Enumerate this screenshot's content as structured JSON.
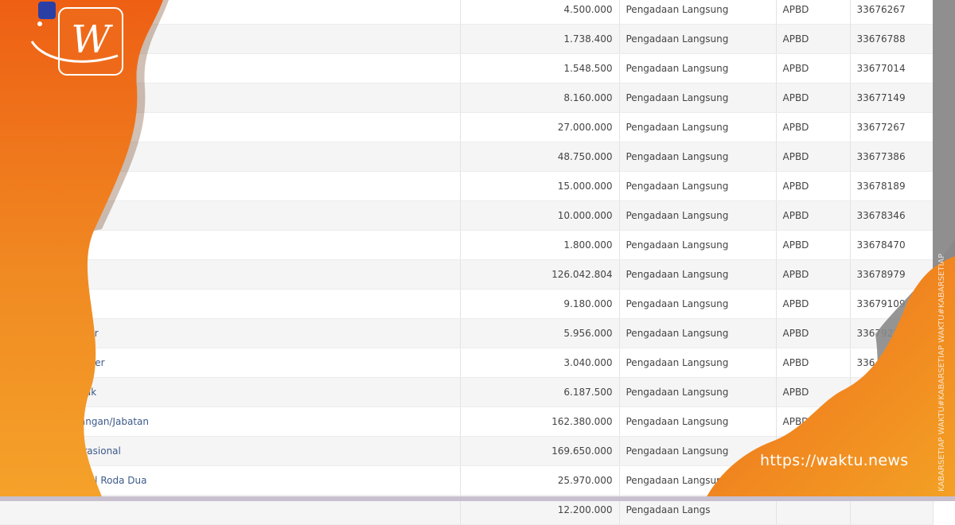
{
  "table": {
    "rows": [
      {
        "name": "",
        "value": "4.500.000",
        "method": "Pengadaan Langsung",
        "source": "APBD",
        "code": "33676267"
      },
      {
        "name": "",
        "value": "1.738.400",
        "method": "Pengadaan Langsung",
        "source": "APBD",
        "code": "33676788"
      },
      {
        "name": "",
        "value": "1.548.500",
        "method": "Pengadaan Langsung",
        "source": "APBD",
        "code": "33677014"
      },
      {
        "name": "",
        "value": "8.160.000",
        "method": "Pengadaan Langsung",
        "source": "APBD",
        "code": "33677149"
      },
      {
        "name": "",
        "value": "27.000.000",
        "method": "Pengadaan Langsung",
        "source": "APBD",
        "code": "33677267"
      },
      {
        "name": "",
        "value": "48.750.000",
        "method": "Pengadaan Langsung",
        "source": "APBD",
        "code": "33677386"
      },
      {
        "name": "",
        "value": "15.000.000",
        "method": "Pengadaan Langsung",
        "source": "APBD",
        "code": "33678189"
      },
      {
        "name": "",
        "value": "10.000.000",
        "method": "Pengadaan Langsung",
        "source": "APBD",
        "code": "33678346"
      },
      {
        "name": "",
        "value": "1.800.000",
        "method": "Pengadaan Langsung",
        "source": "APBD",
        "code": "33678470"
      },
      {
        "name": "",
        "value": "126.042.804",
        "method": "Pengadaan Langsung",
        "source": "APBD",
        "code": "33678979"
      },
      {
        "name": "",
        "value": "9.180.000",
        "method": "Pengadaan Langsung",
        "source": "APBD",
        "code": "33679109"
      },
      {
        "name": "alis Kantor",
        "value": "5.956.000",
        "method": "Pengadaan Langsung",
        "source": "APBD",
        "code": "3367921"
      },
      {
        "name": "s dan Cover",
        "value": "3.040.000",
        "method": "Pengadaan Langsung",
        "source": "APBD",
        "code": "336"
      },
      {
        "name": "han Cetak",
        "value": "6.187.500",
        "method": "Pengadaan Langsung",
        "source": "APBD",
        "code": ""
      },
      {
        "name": "r Perorangan/Jabatan",
        "value": "162.380.000",
        "method": "Pengadaan Langsung",
        "source": "APBD",
        "code": ""
      },
      {
        "name": "at /Operasional",
        "value": "169.650.000",
        "method": "Pengadaan Langsung",
        "source": "",
        "code": ""
      },
      {
        "name": "perasional Roda Dua",
        "value": "25.970.000",
        "method": "Pengadaan Langsun",
        "source": "",
        "code": ""
      },
      {
        "name": "",
        "value": "12.200.000",
        "method": "Pengadaan Langs",
        "source": "",
        "code": ""
      }
    ]
  },
  "brand": {
    "logo_letter": "W",
    "url": "https://waktu.news",
    "watermark": "KABARSETIAP WAKTU#KABARSETIAP WAKTU#KABARSETIAP WAKTU",
    "primary_color": "#ee6a1a",
    "secondary_color": "#f5a623"
  }
}
